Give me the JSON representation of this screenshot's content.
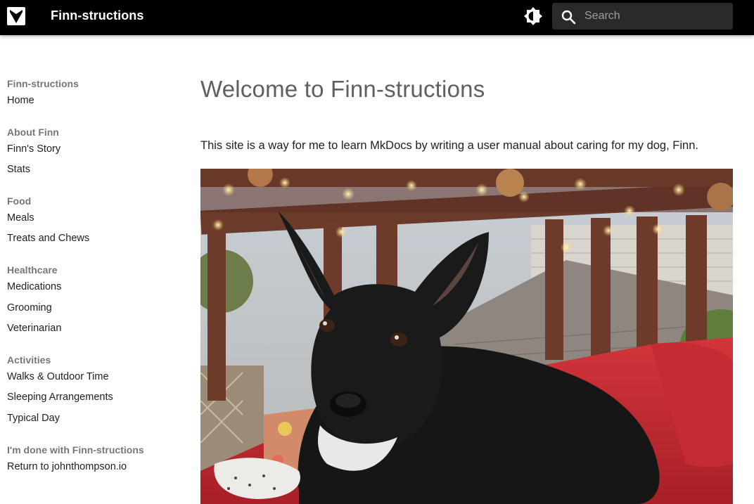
{
  "header": {
    "site_title": "Finn-structions",
    "logo_icon": "heart-logo-icon",
    "theme_toggle_icon": "brightness-icon",
    "search": {
      "icon": "search-icon",
      "placeholder": "Search",
      "value": ""
    }
  },
  "sidebar": {
    "sections": [
      {
        "title": "Finn-structions",
        "items": [
          "Home"
        ]
      },
      {
        "title": "About Finn",
        "items": [
          "Finn's Story",
          "Stats"
        ]
      },
      {
        "title": "Food",
        "items": [
          "Meals",
          "Treats and Chews"
        ]
      },
      {
        "title": "Healthcare",
        "items": [
          "Medications",
          "Grooming",
          "Veterinarian"
        ]
      },
      {
        "title": "Activities",
        "items": [
          "Walks & Outdoor Time",
          "Sleeping Arrangements",
          "Typical Day"
        ]
      },
      {
        "title": "I'm done with Finn-structions",
        "items": [
          "Return to johnthompson.io"
        ]
      }
    ]
  },
  "main": {
    "title": "Welcome to Finn-structions",
    "intro": "This site is a way for me to learn MkDocs by writing a user manual about caring for my dog, Finn."
  },
  "colors": {
    "header_bg": "#000000",
    "search_bg": "#2a2a2a",
    "section_title": "#777777",
    "page_title": "#5f5f5f"
  }
}
